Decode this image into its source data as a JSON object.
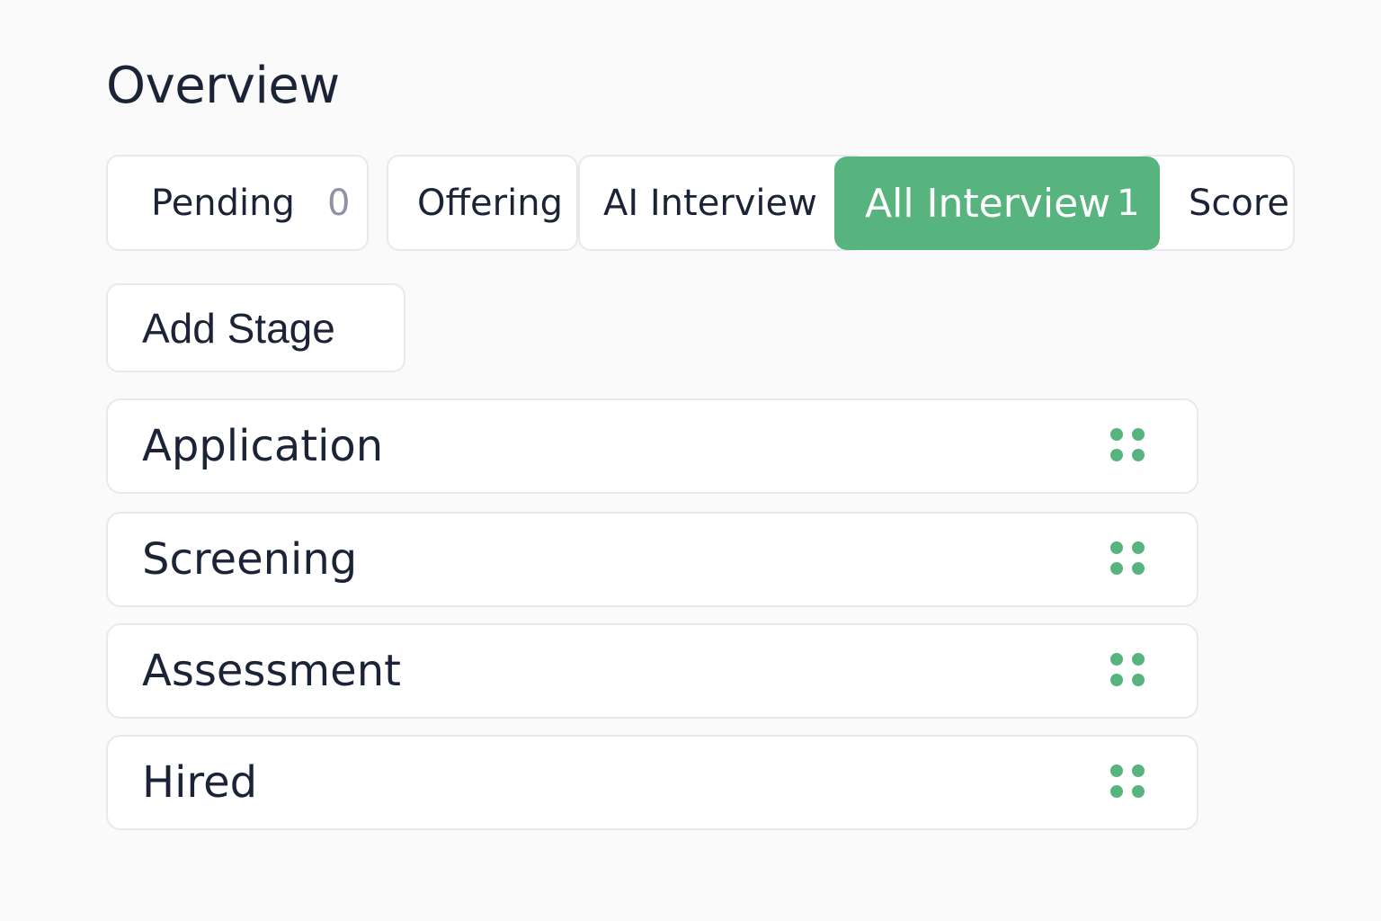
{
  "header": {
    "title": "Overview"
  },
  "tabs": {
    "pending": {
      "label": "Pending",
      "count": "0"
    },
    "offering": {
      "label": "Offering"
    },
    "ai_interview": {
      "label": "AI Interview"
    },
    "all_interview": {
      "label": "All Interview",
      "count": "1",
      "active": true
    },
    "score": {
      "label": "Score"
    }
  },
  "actions": {
    "add_stage_label": "Add Stage"
  },
  "stages": [
    {
      "label": "Application"
    },
    {
      "label": "Screening"
    },
    {
      "label": "Assessment"
    },
    {
      "label": "Hired"
    }
  ],
  "colors": {
    "accent": "#57b47e",
    "text": "#1b2436",
    "muted": "#8c93a6",
    "border": "#e7e9ee",
    "background": "#fafafb"
  },
  "icons": {
    "stage_handle": "drag-handle-icon"
  }
}
